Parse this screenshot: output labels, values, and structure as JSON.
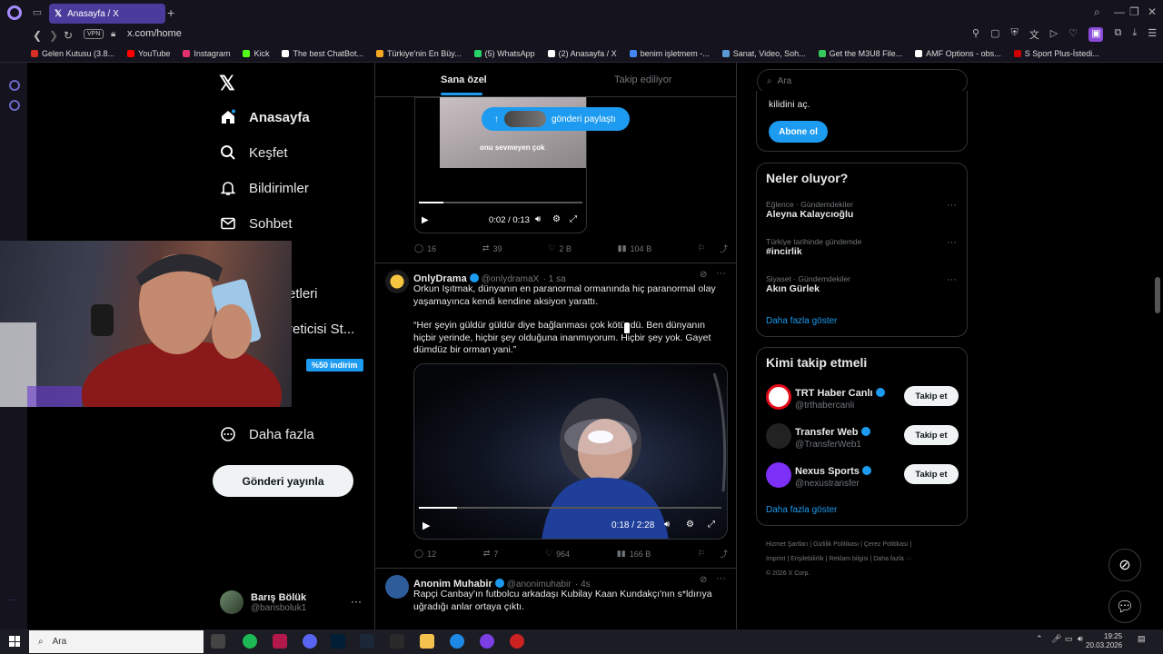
{
  "browser": {
    "tab_title": "Anasayfa / X",
    "url": "x.com/home",
    "vpn_label": "VPN",
    "bookmarks": [
      {
        "label": "Gelen Kutusu (3.8...",
        "color": "#d93025"
      },
      {
        "label": "YouTube",
        "color": "#ff0000"
      },
      {
        "label": "Instagram",
        "color": "#e1306c"
      },
      {
        "label": "Kick",
        "color": "#53fc18"
      },
      {
        "label": "The best ChatBot...",
        "color": "#ffffff"
      },
      {
        "label": "Türkiye'nin En Büy...",
        "color": "#f5a623"
      },
      {
        "label": "(5) WhatsApp",
        "color": "#25d366"
      },
      {
        "label": "(2) Anasayfa / X",
        "color": "#ffffff"
      },
      {
        "label": "benim işletmem -...",
        "color": "#4285f4"
      },
      {
        "label": "Sanat, Video, Soh...",
        "color": "#5b9bd5"
      },
      {
        "label": "Get the M3U8 File...",
        "color": "#34c759"
      },
      {
        "label": "AMF Options - obs...",
        "color": "#ffffff"
      },
      {
        "label": "S Sport Plus-İstedi...",
        "color": "#cc0000"
      }
    ]
  },
  "leftnav": {
    "items": [
      {
        "label": "Anasayfa",
        "icon": "home-icon"
      },
      {
        "label": "Keşfet",
        "icon": "search-icon"
      },
      {
        "label": "Bildirimler",
        "icon": "bell-icon"
      },
      {
        "label": "Sohbet",
        "icon": "mail-icon"
      }
    ],
    "partial_1": "etleri",
    "partial_2": "reticisi St...",
    "discount": "%50 indirim",
    "more": "Daha fazla",
    "post_button": "Gönderi yayınla",
    "account_name": "Barış Bölük",
    "account_handle": "@barisboluk1"
  },
  "tabs": {
    "for_you": "Sana özel",
    "following": "Takip ediliyor"
  },
  "pill": {
    "label": "gönderi paylaştı"
  },
  "post1": {
    "video_caption": "onu sevmeyen çok",
    "video_time": "0:02 / 0:13",
    "video_progress": 0.15,
    "replies": "16",
    "reposts": "39",
    "likes": "2 B",
    "views": "104 B"
  },
  "post2": {
    "name": "OnlyDrama",
    "handle": "@onlydramaX",
    "time": "· 1 sa",
    "text_1": "Orkun Işıtmak, dünyanın en paranormal ormanında hiç paranormal olay yaşamayınca kendi kendine aksiyon yarattı.",
    "text_2": "“Her şeyin güldür güldür diye bağlanması çok kötüydü. Ben dünyanın hiçbir yerinde, hiçbir şey olduğuna inanmıyorum. Hiçbir şey yok. Gayet dümdüz bir orman yani.”",
    "video_time": "0:18 / 2:28",
    "video_progress": 0.125,
    "replies": "12",
    "reposts": "7",
    "likes": "964",
    "views": "166 B"
  },
  "post3": {
    "name": "Anonim Muhabir",
    "handle": "@anonimuhabir",
    "time": "· 4s",
    "text": "Rapçi Canbay'ın futbolcu arkadaşı Kubilay Kaan Kundakçı'nın s*ldırıya uğradığı anlar ortaya çıktı."
  },
  "right": {
    "search_placeholder": "Ara",
    "premium_text": "kilidini aç.",
    "subscribe": "Abone ol",
    "whats_happening": "Neler oluyor?",
    "trends": [
      {
        "meta": "Eğlence · Gündemdekiler",
        "name": "Aleyna Kalaycıoğlu"
      },
      {
        "meta": "Türkiye tarihinde gündemde",
        "name": "#incirlik"
      },
      {
        "meta": "Siyaset · Gündemdekiler",
        "name": "Akın Gürlek"
      }
    ],
    "show_more": "Daha fazla göster",
    "who_to_follow": "Kimi takip etmeli",
    "suggestions": [
      {
        "name": "TRT Haber Canlı",
        "handle": "@trthabercanli",
        "color": "#e30a17"
      },
      {
        "name": "Transfer Web",
        "handle": "@TransferWeb1",
        "color": "#222222"
      },
      {
        "name": "Nexus Sports",
        "handle": "@nexustransfer",
        "color": "#7b2ff7"
      }
    ],
    "follow_label": "Takip et",
    "footer_1": "Hizmet Şartları  |  Gizlilik Politikası  |  Çerez Politikası  |",
    "footer_2": "Imprint  |  Erişilebilirlik  |  Reklam bilgisi  |  Daha fazla ···",
    "footer_3": "© 2026 X Corp."
  },
  "taskbar": {
    "search": "Ara",
    "time": "19:25",
    "date": "20.03.2026"
  }
}
